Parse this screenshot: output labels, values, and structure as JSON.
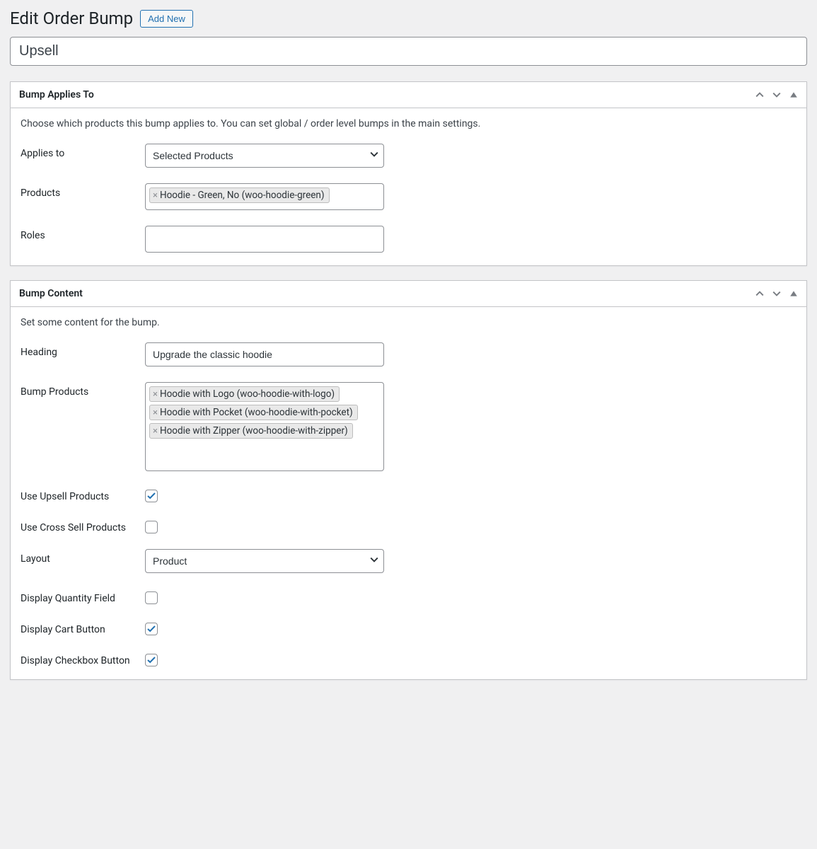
{
  "header": {
    "title": "Edit Order Bump",
    "add_new_label": "Add New"
  },
  "title_value": "Upsell",
  "panels": {
    "applies": {
      "heading": "Bump Applies To",
      "description": "Choose which products this bump applies to. You can set global / order level bumps in the main settings.",
      "applies_to_label": "Applies to",
      "applies_to_value": "Selected Products",
      "products_label": "Products",
      "product_tags": [
        "Hoodie - Green, No (woo-hoodie-green)"
      ],
      "roles_label": "Roles"
    },
    "content": {
      "heading": "Bump Content",
      "description": "Set some content for the bump.",
      "heading_label": "Heading",
      "heading_value": "Upgrade the classic hoodie",
      "bump_products_label": "Bump Products",
      "bump_product_tags": [
        "Hoodie with Logo (woo-hoodie-with-logo)",
        "Hoodie with Pocket (woo-hoodie-with-pocket)",
        "Hoodie with Zipper (woo-hoodie-with-zipper)"
      ],
      "use_upsell_label": "Use Upsell Products",
      "use_upsell_checked": true,
      "use_cross_label": "Use Cross Sell Products",
      "use_cross_checked": false,
      "layout_label": "Layout",
      "layout_value": "Product",
      "display_qty_label": "Display Quantity Field",
      "display_qty_checked": false,
      "display_cart_label": "Display Cart Button",
      "display_cart_checked": true,
      "display_checkbox_label": "Display Checkbox Button",
      "display_checkbox_checked": true
    }
  }
}
